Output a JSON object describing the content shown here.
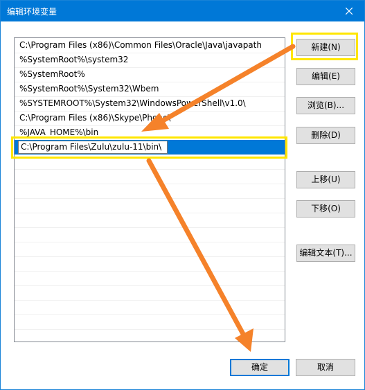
{
  "window": {
    "title": "编辑环境变量",
    "close_icon": "close-icon"
  },
  "paths": [
    "C:\\Program Files (x86)\\Common Files\\Oracle\\Java\\javapath",
    "%SystemRoot%\\system32",
    "%SystemRoot%",
    "%SystemRoot%\\System32\\Wbem",
    "%SYSTEMROOT%\\System32\\WindowsPowerShell\\v1.0\\",
    "C:\\Program Files (x86)\\Skype\\Phone\\",
    "%JAVA_HOME%\\bin"
  ],
  "editing_value": "C:\\Program Files\\Zulu\\zulu-11\\bin\\",
  "buttons": {
    "new": "新建(N)",
    "edit": "编辑(E)",
    "browse": "浏览(B)...",
    "delete": "删除(D)",
    "move_up": "上移(U)",
    "move_down": "下移(O)",
    "edit_text": "编辑文本(T)...",
    "ok": "确定",
    "cancel": "取消"
  },
  "colors": {
    "titlebar": "#0078d7",
    "selection": "#0078d7",
    "highlight": "#ffe600",
    "arrow": "#f5822a"
  }
}
